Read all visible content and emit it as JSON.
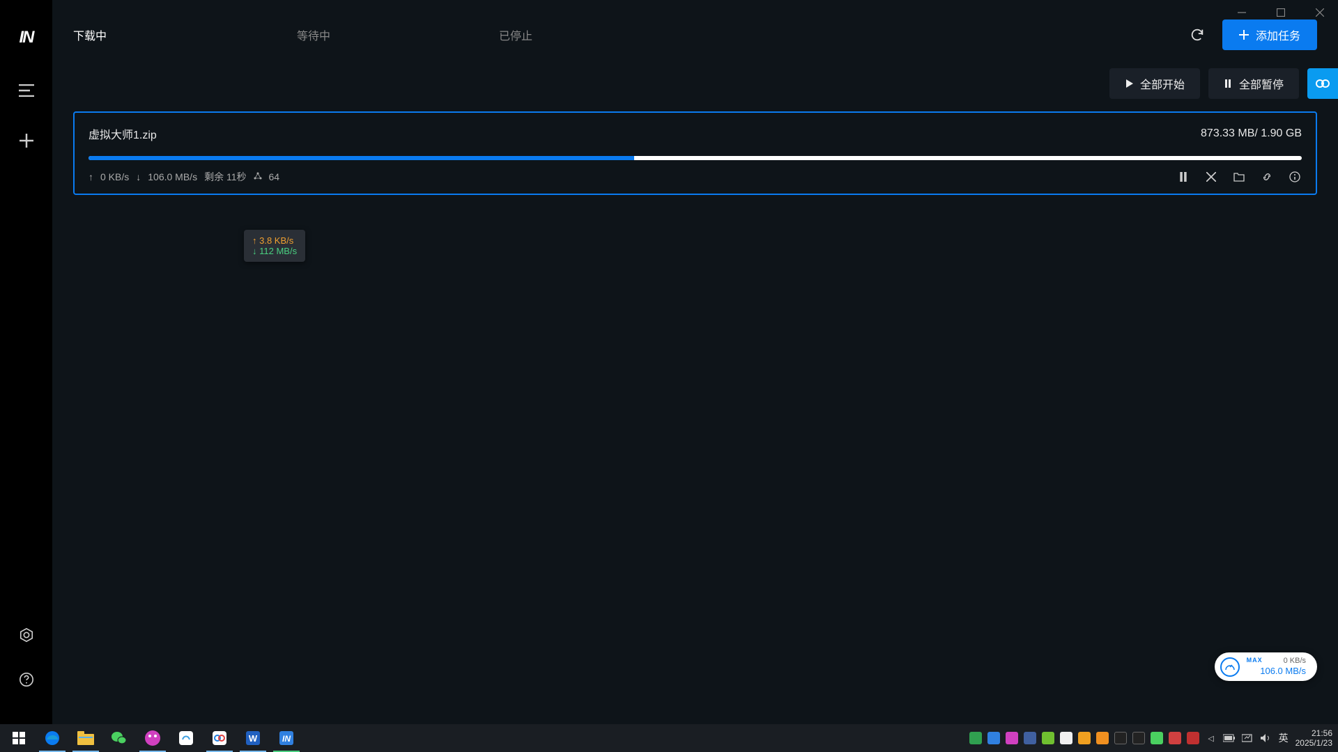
{
  "sidebar": {
    "logo": "IN"
  },
  "tabs": {
    "downloading": "下载中",
    "waiting": "等待中",
    "stopped": "已停止"
  },
  "header": {
    "add_task": "添加任务",
    "start_all": "全部开始",
    "pause_all": "全部暂停"
  },
  "download": {
    "filename": "虚拟大师1.zip",
    "size_downloaded": "873.33 MB",
    "size_total": "1.90 GB",
    "size_display": "873.33 MB/ 1.90 GB",
    "progress_percent": 45,
    "upload_speed": "0 KB/s",
    "download_speed": "106.0 MB/s",
    "time_remaining": "剩余 11秒",
    "peers": "64"
  },
  "tooltip": {
    "upload": "3.8 KB/s",
    "download": "112 MB/s"
  },
  "speed_badge": {
    "label_max": "MAX",
    "up": "0 KB/s",
    "down": "106.0 MB/s"
  },
  "taskbar": {
    "ime": "英",
    "time": "21:56",
    "date": "2025/1/23"
  }
}
